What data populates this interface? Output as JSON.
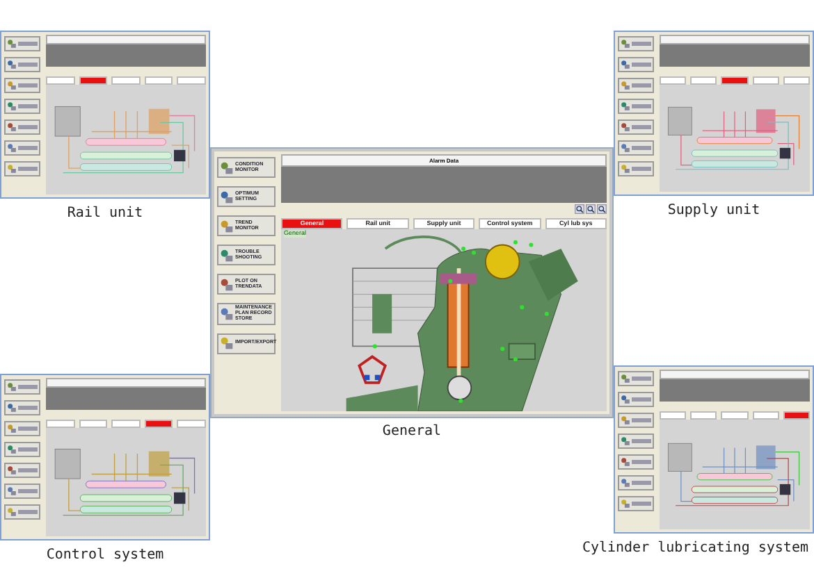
{
  "windows": [
    {
      "kind": "rail",
      "caption": "Rail unit",
      "tabs": [
        {
          "selected": false
        },
        {
          "selected": true
        },
        {
          "selected": false
        },
        {
          "selected": false
        },
        {
          "selected": false
        }
      ]
    },
    {
      "kind": "supply",
      "caption": "Supply unit",
      "tabs": [
        {
          "selected": false
        },
        {
          "selected": false
        },
        {
          "selected": true
        },
        {
          "selected": false
        },
        {
          "selected": false
        }
      ]
    },
    {
      "kind": "control",
      "caption": "Control system",
      "tabs": [
        {
          "selected": false
        },
        {
          "selected": false
        },
        {
          "selected": false
        },
        {
          "selected": true
        },
        {
          "selected": false
        }
      ]
    },
    {
      "kind": "lubrication",
      "caption": "Cylinder lubricating system",
      "tabs": [
        {
          "selected": false
        },
        {
          "selected": false
        },
        {
          "selected": false
        },
        {
          "selected": false
        },
        {
          "selected": true
        }
      ]
    },
    {
      "kind": "engine",
      "caption": "General",
      "alarm_title": "Alarm Data",
      "view_label": "General",
      "sidebar": [
        "CONDITION MONITOR",
        "OPTIMUM SETTING",
        "TREND MONITOR",
        "TROUBLE SHOOTING",
        "PLOT ON TRENDATA",
        "MAINTENANCE PLAN RECORD STORE",
        "IMPORT/EXPORT"
      ],
      "tabs": [
        {
          "label": "General",
          "selected": true
        },
        {
          "label": "Rail unit",
          "selected": false
        },
        {
          "label": "Supply unit",
          "selected": false
        },
        {
          "label": "Control system",
          "selected": false
        },
        {
          "label": "Cyl lub sys",
          "selected": false
        }
      ]
    }
  ]
}
